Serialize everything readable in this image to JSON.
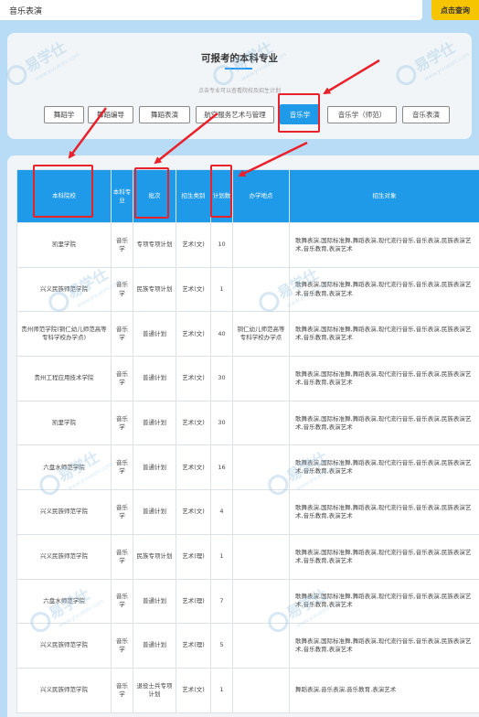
{
  "search": {
    "value": "音乐表演",
    "button_label": "点击查询"
  },
  "majors": {
    "title": "可报考的本科专业",
    "hint": "点击专业可以查看院校及招生计划",
    "items": [
      {
        "label": "舞蹈学"
      },
      {
        "label": "舞蹈编导"
      },
      {
        "label": "舞蹈表演"
      },
      {
        "label": "航空服务艺术与管理"
      },
      {
        "label": "音乐学",
        "active": true
      },
      {
        "label": "音乐学（师范）"
      },
      {
        "label": "音乐表演"
      }
    ]
  },
  "table": {
    "headers": [
      "本科院校",
      "本科专业",
      "批次",
      "招生类别",
      "计划数",
      "办学地点",
      "招生对象"
    ],
    "rows": [
      {
        "school": "凯里学院",
        "major": "音乐学",
        "batch": "专项专项计划",
        "category": "艺术(文)",
        "plan": "10",
        "location": "",
        "objective": "歌舞表演,国际标准舞,舞蹈表演,现代流行音乐,音乐表演,民族表演艺术,音乐教育,表演艺术"
      },
      {
        "school": "兴义民族师范学院",
        "major": "音乐学",
        "batch": "民族专项计划",
        "category": "艺术(文)",
        "plan": "1",
        "location": "",
        "objective": "歌舞表演,国际标准舞,舞蹈表演,现代流行音乐,音乐表演,民族表演艺术,音乐教育,表演艺术"
      },
      {
        "school": "贵州师范学院(铜仁幼儿师范高等专科学校办学点)",
        "major": "音乐学",
        "batch": "普通计划",
        "category": "艺术(文)",
        "plan": "40",
        "location": "铜仁幼儿师范高等专科学校办学点",
        "objective": "歌舞表演,国际标准舞,舞蹈表演,现代流行音乐,音乐表演,民族表演艺术,音乐教育,表演艺术"
      },
      {
        "school": "贵州工程应用技术学院",
        "major": "音乐学",
        "batch": "普通计划",
        "category": "艺术(文)",
        "plan": "30",
        "location": "",
        "objective": "歌舞表演,国际标准舞,舞蹈表演,现代流行音乐,音乐表演,民族表演艺术,音乐教育,表演艺术"
      },
      {
        "school": "凯里学院",
        "major": "音乐学",
        "batch": "普通计划",
        "category": "艺术(文)",
        "plan": "30",
        "location": "",
        "objective": "歌舞表演,国际标准舞,舞蹈表演,现代流行音乐,音乐表演,民族表演艺术,音乐教育,表演艺术"
      },
      {
        "school": "六盘水师范学院",
        "major": "音乐学",
        "batch": "普通计划",
        "category": "艺术(文)",
        "plan": "16",
        "location": "",
        "objective": "歌舞表演,国际标准舞,舞蹈表演,现代流行音乐,音乐表演,民族表演艺术,音乐教育,表演艺术"
      },
      {
        "school": "兴义民族师范学院",
        "major": "音乐学",
        "batch": "普通计划",
        "category": "艺术(文)",
        "plan": "4",
        "location": "",
        "objective": "歌舞表演,国际标准舞,舞蹈表演,现代流行音乐,音乐表演,民族表演艺术,音乐教育,表演艺术"
      },
      {
        "school": "兴义民族师范学院",
        "major": "音乐学",
        "batch": "民族专项计划",
        "category": "艺术(理)",
        "plan": "1",
        "location": "",
        "objective": "歌舞表演,国际标准舞,舞蹈表演,现代流行音乐,音乐表演,民族表演艺术,音乐教育,表演艺术"
      },
      {
        "school": "六盘水师范学院",
        "major": "音乐学",
        "batch": "普通计划",
        "category": "艺术(理)",
        "plan": "7",
        "location": "",
        "objective": "歌舞表演,国际标准舞,舞蹈表演,现代流行音乐,音乐表演,民族表演艺术,音乐教育,表演艺术"
      },
      {
        "school": "兴义民族师范学院",
        "major": "音乐学",
        "batch": "普通计划",
        "category": "艺术(理)",
        "plan": "5",
        "location": "",
        "objective": "歌舞表演,国际标准舞,舞蹈表演,现代流行音乐,音乐表演,民族表演艺术,音乐教育,表演艺术"
      },
      {
        "school": "兴义民族师范学院",
        "major": "音乐学",
        "batch": "退役士兵专项计划",
        "category": "艺术(文)",
        "plan": "1",
        "location": "",
        "objective": "舞蹈表演,音乐表演,音乐教育,表演艺术"
      }
    ]
  },
  "watermark": {
    "text": "易学仕",
    "sub": "www.yixueshi.com"
  },
  "colors": {
    "accent": "#1e9ae8",
    "search_button": "#f7c400",
    "annotation": "#e8212a",
    "page_bg": "#b8dcf5"
  }
}
